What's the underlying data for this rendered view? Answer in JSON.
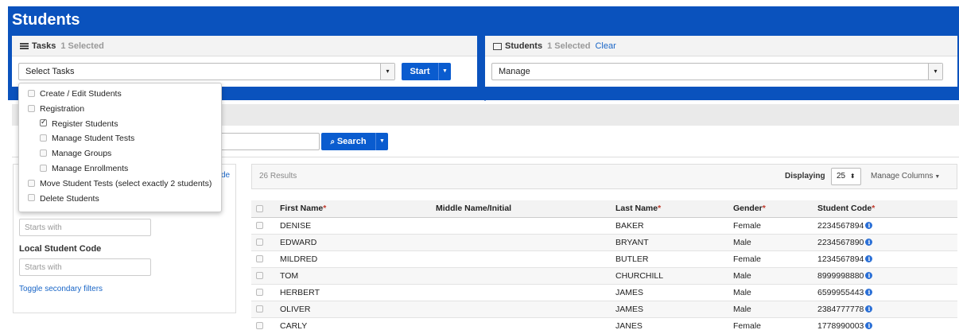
{
  "page_title": "Students",
  "tasks_panel": {
    "title": "Tasks",
    "selected_text": "1 Selected",
    "select_value": "Select Tasks",
    "start_label": "Start"
  },
  "students_panel": {
    "title": "Students",
    "selected_text": "1 Selected",
    "clear_label": "Clear",
    "select_value": "Manage"
  },
  "task_menu": [
    {
      "label": "Create / Edit Students",
      "checked": false,
      "indent": 0
    },
    {
      "label": "Registration",
      "checked": false,
      "indent": 0
    },
    {
      "label": "Register Students",
      "checked": true,
      "indent": 1
    },
    {
      "label": "Manage Student Tests",
      "checked": false,
      "indent": 1
    },
    {
      "label": "Manage Groups",
      "checked": false,
      "indent": 1
    },
    {
      "label": "Manage Enrollments",
      "checked": false,
      "indent": 1
    },
    {
      "label": "Move Student Tests (select exactly 2 students)",
      "checked": false,
      "indent": 0
    },
    {
      "label": "Delete Students",
      "checked": false,
      "indent": 0
    }
  ],
  "search": {
    "button_label": "Search"
  },
  "filters": {
    "partial_link": "de",
    "starts_with_placeholder_1": "Starts with",
    "local_student_code_label": "Local Student Code",
    "starts_with_placeholder_2": "Starts with",
    "toggle_link": "Toggle secondary filters"
  },
  "results": {
    "count_text": "26 Results",
    "displaying_label": "Displaying",
    "per_page": "25",
    "manage_columns": "Manage Columns"
  },
  "table": {
    "columns": [
      "First Name",
      "Middle Name/Initial",
      "Last Name",
      "Gender",
      "Student Code"
    ],
    "rows": [
      [
        "DENISE",
        "",
        "BAKER",
        "Female",
        "2234567894"
      ],
      [
        "EDWARD",
        "",
        "BRYANT",
        "Male",
        "2234567890"
      ],
      [
        "MILDRED",
        "",
        "BUTLER",
        "Female",
        "1234567894"
      ],
      [
        "TOM",
        "",
        "CHURCHILL",
        "Male",
        "8999998880"
      ],
      [
        "HERBERT",
        "",
        "JAMES",
        "Male",
        "6599955443"
      ],
      [
        "OLIVER",
        "",
        "JAMES",
        "Male",
        "2384777778"
      ],
      [
        "CARLY",
        "",
        "JANES",
        "Female",
        "1778990003"
      ]
    ]
  },
  "colors": {
    "brand_blue": "#0a52bd",
    "button_blue": "#0a5ccf",
    "link_blue": "#1a66c7"
  }
}
